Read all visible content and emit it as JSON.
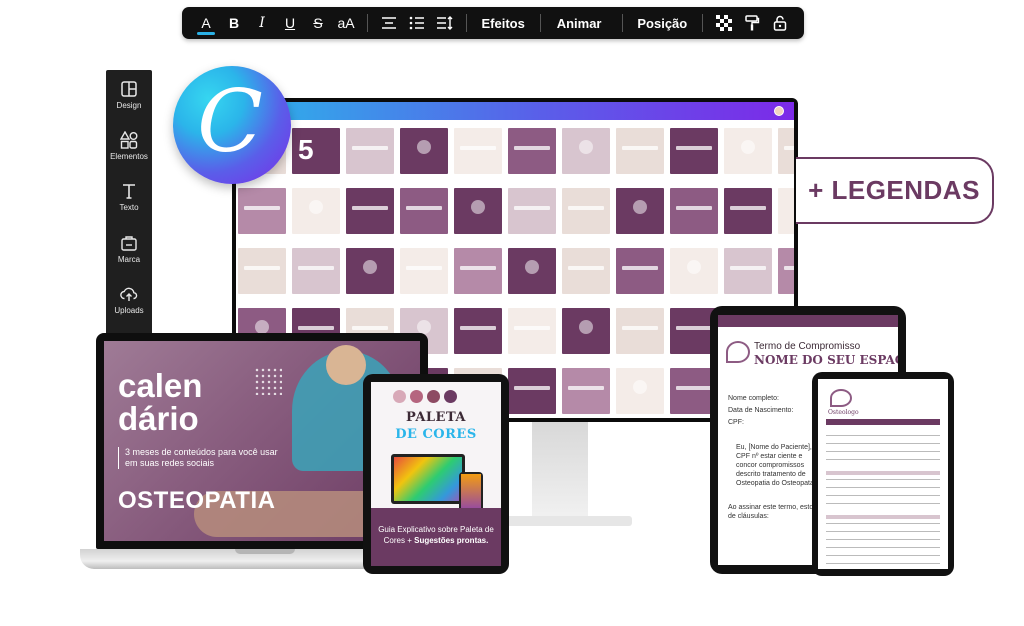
{
  "toolbar": {
    "buttons": [
      {
        "name": "text-color-button",
        "glyph": "A"
      },
      {
        "name": "bold-button",
        "glyph": "B"
      },
      {
        "name": "italic-button",
        "glyph": "I"
      },
      {
        "name": "underline-button",
        "glyph": "U"
      },
      {
        "name": "strikethrough-button",
        "glyph": "S"
      },
      {
        "name": "case-button",
        "glyph": "aA"
      }
    ],
    "effects_label": "Efeitos",
    "animate_label": "Animar",
    "position_label": "Posição"
  },
  "sidebar": {
    "items": [
      {
        "label": "Design",
        "icon": "layout-icon"
      },
      {
        "label": "Elementos",
        "icon": "shapes-icon"
      },
      {
        "label": "Texto",
        "icon": "text-icon"
      },
      {
        "label": "Marca",
        "icon": "brand-icon"
      },
      {
        "label": "Uploads",
        "icon": "upload-icon"
      }
    ]
  },
  "logo": {
    "letter": "C"
  },
  "badge": {
    "label": "+ LEGENDAS"
  },
  "monitor": {
    "tile_number": "5"
  },
  "laptop": {
    "title_line1": "calen",
    "title_line2": "dário",
    "subtitle": "3 meses de conteúdos para você usar em suas redes sociais",
    "topic": "OSTEOPATIA"
  },
  "palette_tablet": {
    "title1": "PALETA",
    "title2": "DE CORES",
    "footer_line1": "Guia Explicativo sobre Paleta de",
    "footer_plain": "Cores + ",
    "footer_bold": "Sugestões prontas.",
    "colors": [
      "#d8a9b8",
      "#b5657f",
      "#8d4a63",
      "#6b3a62"
    ]
  },
  "term_tablet": {
    "title1": "Termo de Compromisso",
    "title2": "NOME DO SEU ESPAÇO",
    "field1": "Nome completo:",
    "field2": "Data de Nascimento:",
    "field3": "CPF:",
    "paragraph": "Eu, [Nome do Paciente], CPF nº estar ciente e concor compromissos descrito tratamento de Osteopatia do Osteopata]",
    "ending": "Ao assinar este termo, estou de cláusulas:"
  },
  "form_tablet": {
    "brand": "Osteologo"
  },
  "colors": {
    "accent": "#6b3a62",
    "canva_blue": "#2bb5ea",
    "canva_purple": "#7c2ae8"
  }
}
